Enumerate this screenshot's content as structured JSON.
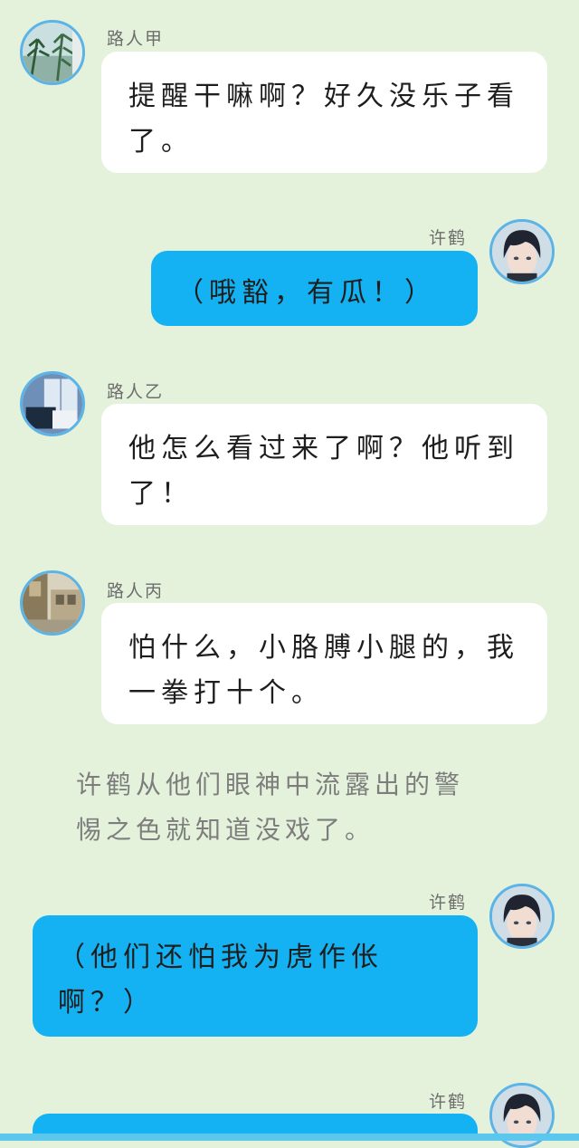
{
  "messages": [
    {
      "sender": "路人甲",
      "text": "提醒干嘛啊？好久没乐子看了。",
      "side": "left",
      "avatar_icon": "plants-avatar-icon"
    },
    {
      "sender": "许鹤",
      "text": "（哦豁，有瓜！）",
      "side": "right",
      "avatar_icon": "dark-hair-boy-avatar-icon"
    },
    {
      "sender": "路人乙",
      "text": "他怎么看过来了啊？他听到了！",
      "side": "left",
      "avatar_icon": "window-room-avatar-icon"
    },
    {
      "sender": "路人丙",
      "text": "怕什么，小胳膊小腿的，我一拳打十个。",
      "side": "left",
      "avatar_icon": "street-avatar-icon"
    },
    {
      "sender": "许鹤",
      "text": "（他们还怕我为虎作伥啊？）",
      "side": "right",
      "avatar_icon": "dark-hair-boy-avatar-icon"
    },
    {
      "sender": "许鹤",
      "text": "",
      "side": "right",
      "avatar_icon": "dark-hair-boy-avatar-icon"
    }
  ],
  "narration": "许鹤从他们眼神中流露出的警惕之色就知道没戏了。",
  "colors": {
    "background": "#e4f2dc",
    "left_bubble": "#ffffff",
    "right_bubble": "#14b2f2",
    "avatar_border": "#5bb3e6",
    "narration_text": "#7d7d7d"
  }
}
